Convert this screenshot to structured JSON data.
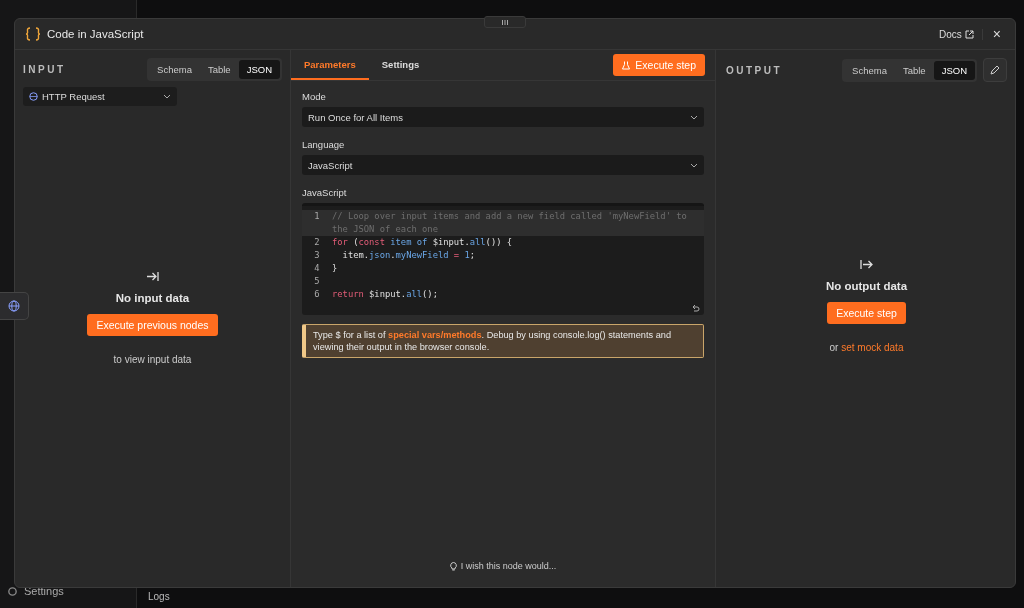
{
  "background": {
    "sidebar_item": "Settings",
    "logs_label": "Logs"
  },
  "window": {
    "title": "Code in JavaScript",
    "docs_link": "Docs",
    "close": "×"
  },
  "input_panel": {
    "title": "INPUT",
    "view_tabs": [
      {
        "label": "Schema",
        "selected": false
      },
      {
        "label": "Table",
        "selected": false
      },
      {
        "label": "JSON",
        "selected": true
      }
    ],
    "source": "HTTP Request",
    "empty_title": "No input data",
    "button": "Execute previous nodes",
    "hint": "to view input data"
  },
  "parameters": {
    "tabs": [
      {
        "label": "Parameters",
        "selected": true
      },
      {
        "label": "Settings",
        "selected": false
      }
    ],
    "execute_button": "Execute step",
    "fields": [
      {
        "label": "Mode",
        "value": "Run Once for All Items"
      },
      {
        "label": "Language",
        "value": "JavaScript"
      }
    ],
    "code_label": "JavaScript",
    "code_lines": [
      {
        "number": "1",
        "active": true,
        "tokens": [
          {
            "kind": "comment",
            "text": "// Loop over input items and add a new field called 'myNewField' to the JSON of each one"
          }
        ]
      },
      {
        "number": "2",
        "active": false,
        "tokens": [
          {
            "kind": "keyword",
            "text": "for"
          },
          {
            "kind": "plain",
            "text": " ("
          },
          {
            "kind": "keyword",
            "text": "const"
          },
          {
            "kind": "name",
            "text": " item"
          },
          {
            "kind": "name",
            "text": " of"
          },
          {
            "kind": "plain",
            "text": " $input."
          },
          {
            "kind": "name",
            "text": "all"
          },
          {
            "kind": "plain",
            "text": "()) {"
          }
        ]
      },
      {
        "number": "3",
        "active": false,
        "tokens": [
          {
            "kind": "plain",
            "text": "  item."
          },
          {
            "kind": "name",
            "text": "json"
          },
          {
            "kind": "plain",
            "text": "."
          },
          {
            "kind": "name",
            "text": "myNewField"
          },
          {
            "kind": "keyword",
            "text": " = "
          },
          {
            "kind": "name",
            "text": "1"
          },
          {
            "kind": "plain",
            "text": ";"
          }
        ]
      },
      {
        "number": "4",
        "active": false,
        "tokens": [
          {
            "kind": "plain",
            "text": "}"
          }
        ]
      },
      {
        "number": "5",
        "active": false
      },
      {
        "number": "6",
        "active": false,
        "tokens": [
          {
            "kind": "keyword",
            "text": "return"
          },
          {
            "kind": "plain",
            "text": " $input."
          },
          {
            "kind": "name",
            "text": "all"
          },
          {
            "kind": "plain",
            "text": "();"
          }
        ]
      }
    ],
    "notice": {
      "before": "Type $ for a list of ",
      "link": "special vars/methods",
      "after": ". Debug by using console.log() statements and viewing their output in the browser console."
    },
    "feedback": "I wish this node would..."
  },
  "output_panel": {
    "title": "OUTPUT",
    "view_tabs": [
      {
        "label": "Schema",
        "selected": false
      },
      {
        "label": "Table",
        "selected": false
      },
      {
        "label": "JSON",
        "selected": true
      }
    ],
    "empty_title": "No output data",
    "button": "Execute step",
    "hint_prefix": "or",
    "hint_link": "set mock data"
  }
}
